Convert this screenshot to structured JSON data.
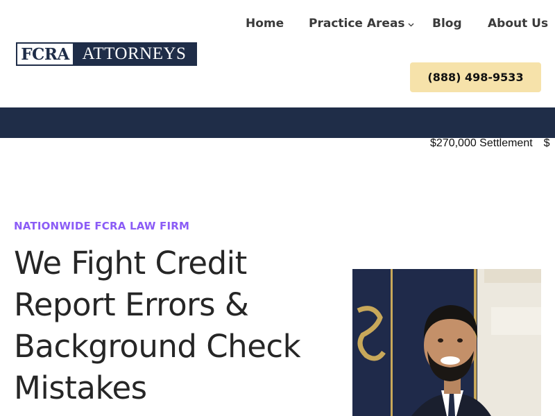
{
  "logo": {
    "left_text": "FCRA",
    "right_text": "ATTORNEYS"
  },
  "nav": {
    "items": [
      {
        "label": "Home"
      },
      {
        "label": "Practice Areas"
      },
      {
        "label": "Blog"
      },
      {
        "label": "About Us"
      }
    ]
  },
  "phone": {
    "label": "(888) 498-9533"
  },
  "ticker": {
    "items": [
      "$270,000 Settlement",
      "$"
    ]
  },
  "hero": {
    "eyebrow": "NATIONWIDE FCRA LAW FIRM",
    "headline": "We Fight Credit Report Errors & Background Check Mistakes"
  },
  "colors": {
    "navy": "#1f2d48",
    "accent_purple": "#8b5cf6",
    "phone_bg": "#f6e2aa"
  },
  "icons": {
    "practice_areas_dropdown": "chevron-down-icon"
  }
}
